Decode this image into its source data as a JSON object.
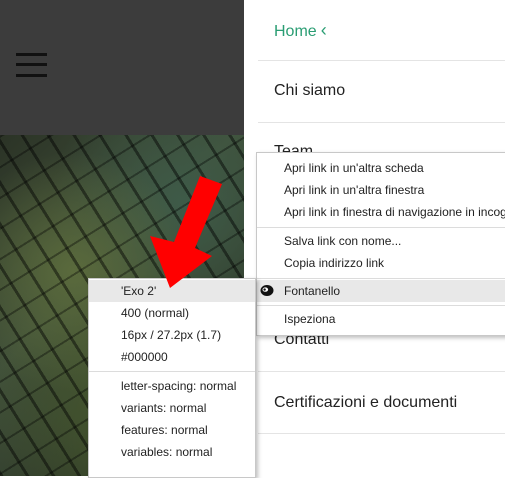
{
  "nav": {
    "home_label": "Home",
    "items": [
      "Chi siamo",
      "Team",
      "Contatti",
      "Certificazioni e documenti"
    ]
  },
  "context_menu": {
    "items": [
      "Apri link in un'altra scheda",
      "Apri link in un'altra finestra",
      "Apri link in finestra di navigazione in incognito",
      "Salva link con nome...",
      "Copia indirizzo link",
      "Fontanello",
      "Ispeziona"
    ]
  },
  "font_popup": {
    "family": "'Exo 2'",
    "weight": "400 (normal)",
    "size": "16px / 27.2px (1.7)",
    "color": "#000000",
    "letter_spacing": "letter-spacing: normal",
    "variants": "variants: normal",
    "features": "features: normal",
    "variables": "variables: normal"
  },
  "colors": {
    "accent": "#2a9d73",
    "arrow": "#ff0000"
  }
}
